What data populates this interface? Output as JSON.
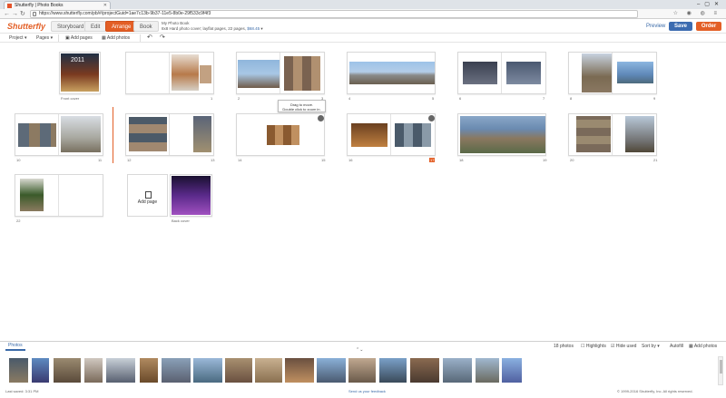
{
  "browser": {
    "tab_title": "Shutterfly | Photo Books",
    "url": "https://www.shutterfly.com/pb/#/projectGuid=1ae7c13b-9b37-11e5-8b0e-29f533c9f4f3"
  },
  "header": {
    "logo": "Shutterfly",
    "tabs": [
      "Storyboard",
      "Edit",
      "Arrange",
      "Book"
    ],
    "active_tab": "Arrange",
    "project_title": "My Photo Book",
    "project_details": "8x8 Hard photo cover; layflat pages, 22 pages,",
    "project_price": "$68.45",
    "preview_label": "Preview",
    "save_label": "Save",
    "order_label": "Order"
  },
  "toolbar": {
    "project_menu": "Project",
    "pages_menu": "Pages",
    "add_pages": "Add pages",
    "add_photos": "Add photos"
  },
  "pages": {
    "front_cover": "Front cover",
    "back_cover": "Back cover",
    "add_page": "Add page",
    "drag_tip_line1": "Drag to move.",
    "drag_tip_line2": "Double click to zoom in.",
    "numbers": [
      "1",
      "2",
      "3",
      "4",
      "5",
      "6",
      "7",
      "8",
      "9",
      "10",
      "11",
      "12",
      "13",
      "14",
      "15",
      "16",
      "17",
      "18",
      "19",
      "20",
      "21",
      "22"
    ]
  },
  "photos_panel": {
    "tab": "Photos",
    "count": "18 photos",
    "highlights": "Highlights",
    "hide_used": "Hide used",
    "sort_by": "Sort by",
    "autofill": "Autofill",
    "add_photos": "Add photos"
  },
  "status": {
    "last_saved": "Last saved: 3:31 PM",
    "feedback": "Send us your feedback",
    "copyright": "© 1999-2016 Shutterfly, Inc. All rights reserved."
  },
  "colors": {
    "brand_orange": "#e35f26",
    "save_blue": "#3b6bb0"
  }
}
